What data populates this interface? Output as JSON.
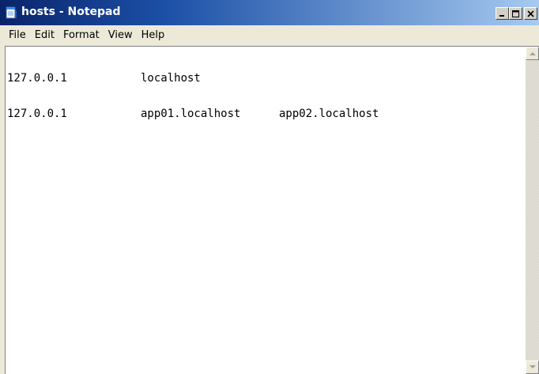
{
  "window": {
    "title": "hosts - Notepad",
    "icon": "notepad-icon",
    "controls": {
      "minimize": "minimize-icon",
      "maximize": "maximize-icon",
      "close": "close-icon"
    }
  },
  "menu": {
    "items": [
      {
        "label": "File"
      },
      {
        "label": "Edit"
      },
      {
        "label": "Format"
      },
      {
        "label": "View"
      },
      {
        "label": "Help"
      }
    ]
  },
  "document": {
    "lines": [
      {
        "ip": "127.0.0.1",
        "host1": "localhost",
        "host2": ""
      },
      {
        "ip": "127.0.0.1",
        "host1": "app01.localhost",
        "host2": "app02.localhost"
      }
    ]
  },
  "colors": {
    "titlebar_start": "#0a246a",
    "titlebar_end": "#a6caf0",
    "chrome": "#ece9d8",
    "editor_bg": "#ffffff"
  }
}
